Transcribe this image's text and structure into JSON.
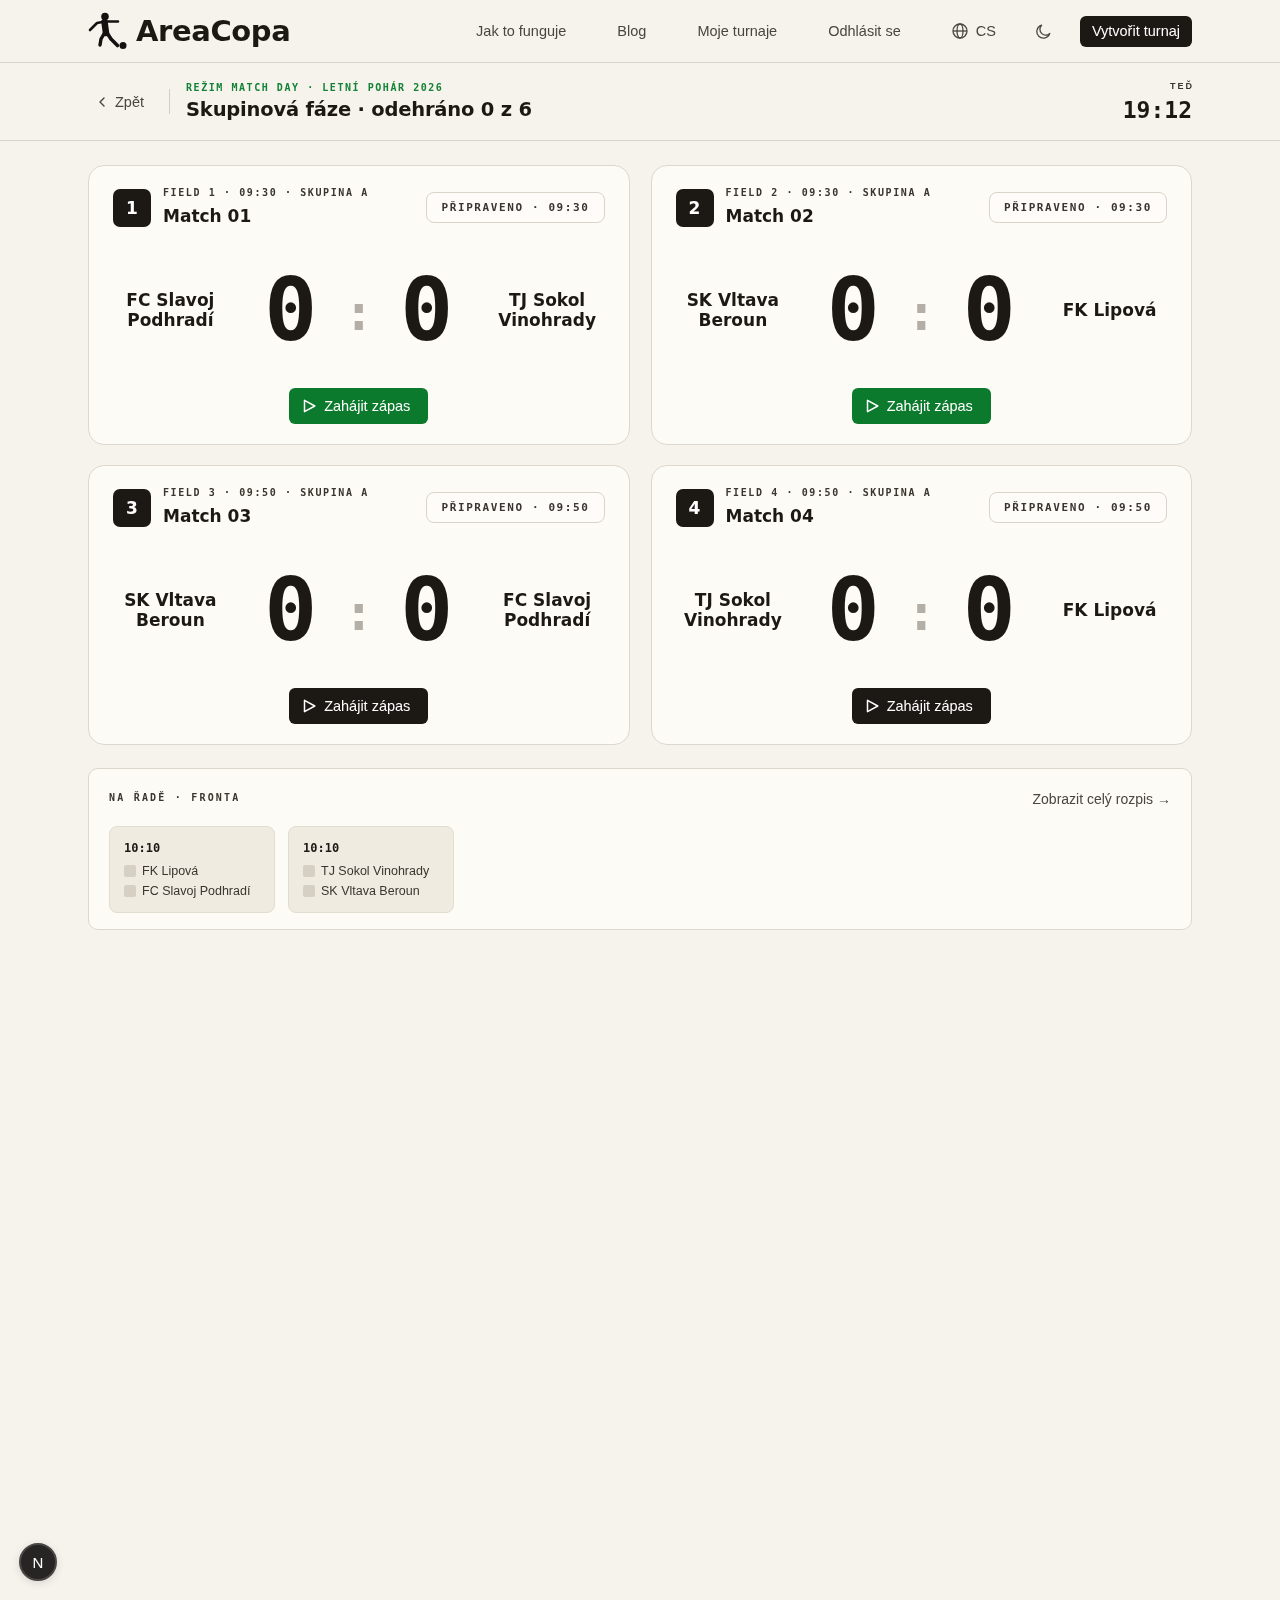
{
  "header": {
    "logo_text": "AreaCopa",
    "nav_links": [
      "Jak to funguje",
      "Blog",
      "Moje turnaje",
      "Odhlásit se"
    ],
    "language": "CS",
    "create_button": "Vytvořit turnaj"
  },
  "subheader": {
    "back": "Zpět",
    "eyebrow": "REŽIM MATCH DAY · LETNÍ POHÁR 2026",
    "title": "Skupinová fáze · odehráno 0 z 6",
    "clock_label": "TEĎ",
    "clock_time": "19:12"
  },
  "matches": [
    {
      "number": "1",
      "meta": "FIELD 1 · 09:30 · SKUPINA A",
      "title": "Match 01",
      "status": "PŘIPRAVENO · 09:30",
      "home_team": "FC Slavoj Podhradí",
      "home_score": "0",
      "separator": ":",
      "away_score": "0",
      "away_team": "TJ Sokol Vinohrady",
      "start_button": {
        "label": "Zahájit zápas",
        "highlighted": true
      }
    },
    {
      "number": "2",
      "meta": "FIELD 2 · 09:30 · SKUPINA A",
      "title": "Match 02",
      "status": "PŘIPRAVENO · 09:30",
      "home_team": "SK Vltava Beroun",
      "home_score": "0",
      "separator": ":",
      "away_score": "0",
      "away_team": "FK Lipová",
      "start_button": {
        "label": "Zahájit zápas",
        "highlighted": true
      }
    },
    {
      "number": "3",
      "meta": "FIELD 3 · 09:50 · SKUPINA A",
      "title": "Match 03",
      "status": "PŘIPRAVENO · 09:50",
      "home_team": "SK Vltava Beroun",
      "home_score": "0",
      "separator": ":",
      "away_score": "0",
      "away_team": "FC Slavoj Podhradí",
      "start_button": {
        "label": "Zahájit zápas",
        "highlighted": false
      }
    },
    {
      "number": "4",
      "meta": "FIELD 4 · 09:50 · SKUPINA A",
      "title": "Match 04",
      "status": "PŘIPRAVENO · 09:50",
      "home_team": "TJ Sokol Vinohrady",
      "home_score": "0",
      "separator": ":",
      "away_score": "0",
      "away_team": "FK Lipová",
      "start_button": {
        "label": "Zahájit zápas",
        "highlighted": false
      }
    }
  ],
  "queue": {
    "title": "NA ŘADĚ · FRONTA",
    "link": "Zobrazit celý rozpis →",
    "items": [
      {
        "time": "10:10",
        "teams": [
          "FK Lipová",
          "FC Slavoj Podhradí"
        ]
      },
      {
        "time": "10:10",
        "teams": [
          "TJ Sokol Vinohrady",
          "SK Vltava Beroun"
        ]
      }
    ]
  },
  "dev_indicator": {
    "label": "N"
  }
}
